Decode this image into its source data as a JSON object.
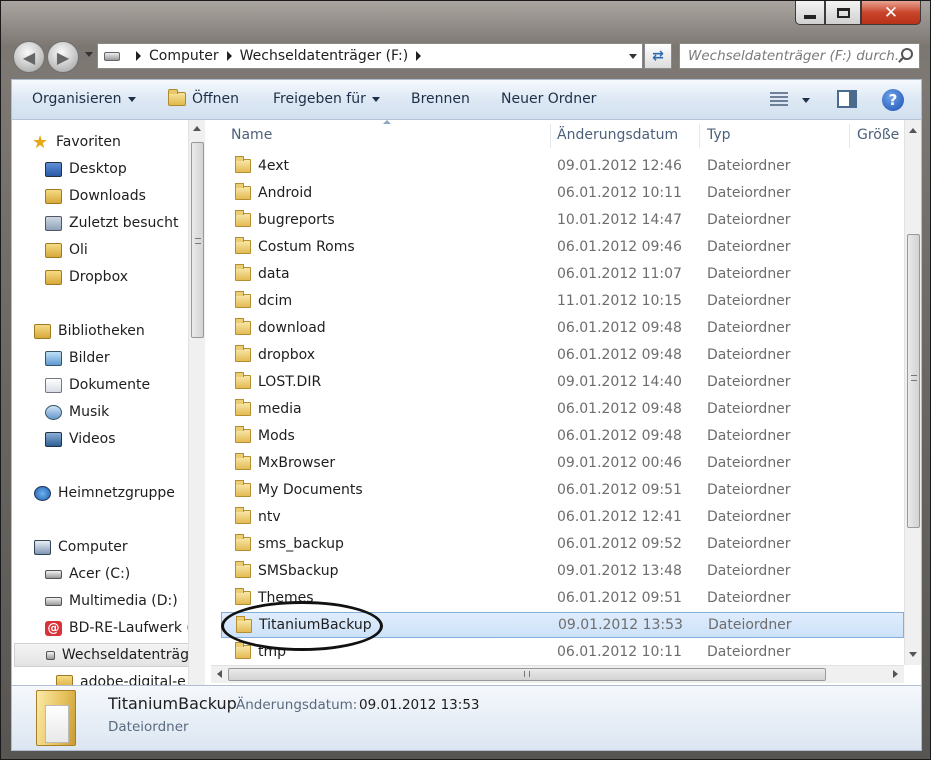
{
  "window": {
    "controls": {
      "minimize": "minimize",
      "maximize": "maximize",
      "close": "✕"
    }
  },
  "nav": {
    "breadcrumbs": [
      "Computer",
      "Wechseldatenträger (F:)"
    ],
    "search_placeholder": "Wechseldatenträger (F:) durch..."
  },
  "toolbar": {
    "organize": "Organisieren",
    "open": "Öffnen",
    "share": "Freigeben für",
    "burn": "Brennen",
    "new_folder": "Neuer Ordner",
    "help": "?"
  },
  "sidebar": {
    "favorites": {
      "label": "Favoriten",
      "items": [
        {
          "label": "Desktop",
          "icon": "desktop-icon"
        },
        {
          "label": "Downloads",
          "icon": "downloads-folder-icon"
        },
        {
          "label": "Zuletzt besucht",
          "icon": "recent-places-icon"
        },
        {
          "label": "Oli",
          "icon": "user-folder-icon"
        },
        {
          "label": "Dropbox",
          "icon": "dropbox-folder-icon"
        }
      ]
    },
    "libraries": {
      "label": "Bibliotheken",
      "items": [
        {
          "label": "Bilder",
          "icon": "pictures-icon"
        },
        {
          "label": "Dokumente",
          "icon": "documents-icon"
        },
        {
          "label": "Musik",
          "icon": "music-icon"
        },
        {
          "label": "Videos",
          "icon": "videos-icon"
        }
      ]
    },
    "homegroup": {
      "label": "Heimnetzgruppe"
    },
    "computer": {
      "label": "Computer",
      "items": [
        {
          "label": "Acer (C:)",
          "icon": "drive-icon"
        },
        {
          "label": "Multimedia (D:)",
          "icon": "drive-icon"
        },
        {
          "label": "BD-RE-Laufwerk (",
          "icon": "bd-drive-icon"
        },
        {
          "label": "Wechseldatenträg",
          "icon": "removable-drive-icon"
        },
        {
          "label": "adobe-digital-e",
          "icon": "folder-icon"
        }
      ]
    }
  },
  "list": {
    "columns": {
      "name": "Name",
      "date": "Änderungsdatum",
      "type": "Typ",
      "size": "Größe"
    },
    "rows": [
      {
        "name": "4ext",
        "date": "09.01.2012 12:46",
        "type": "Dateiordner"
      },
      {
        "name": "Android",
        "date": "06.01.2012 10:11",
        "type": "Dateiordner"
      },
      {
        "name": "bugreports",
        "date": "10.01.2012 14:47",
        "type": "Dateiordner"
      },
      {
        "name": "Costum Roms",
        "date": "06.01.2012 09:46",
        "type": "Dateiordner"
      },
      {
        "name": "data",
        "date": "06.01.2012 11:07",
        "type": "Dateiordner"
      },
      {
        "name": "dcim",
        "date": "11.01.2012 10:15",
        "type": "Dateiordner"
      },
      {
        "name": "download",
        "date": "06.01.2012 09:48",
        "type": "Dateiordner"
      },
      {
        "name": "dropbox",
        "date": "06.01.2012 09:48",
        "type": "Dateiordner"
      },
      {
        "name": "LOST.DIR",
        "date": "09.01.2012 14:40",
        "type": "Dateiordner"
      },
      {
        "name": "media",
        "date": "06.01.2012 09:48",
        "type": "Dateiordner"
      },
      {
        "name": "Mods",
        "date": "06.01.2012 09:48",
        "type": "Dateiordner"
      },
      {
        "name": "MxBrowser",
        "date": "09.01.2012 00:46",
        "type": "Dateiordner"
      },
      {
        "name": "My Documents",
        "date": "06.01.2012 09:51",
        "type": "Dateiordner"
      },
      {
        "name": "ntv",
        "date": "06.01.2012 12:41",
        "type": "Dateiordner"
      },
      {
        "name": "sms_backup",
        "date": "06.01.2012 09:52",
        "type": "Dateiordner"
      },
      {
        "name": "SMSbackup",
        "date": "09.01.2012 13:48",
        "type": "Dateiordner"
      },
      {
        "name": "Themes",
        "date": "06.01.2012 09:51",
        "type": "Dateiordner"
      },
      {
        "name": "TitaniumBackup",
        "date": "09.01.2012 13:53",
        "type": "Dateiordner",
        "selected": true
      },
      {
        "name": "tmp",
        "date": "06.01.2012 10:11",
        "type": "Dateiordner"
      }
    ]
  },
  "details": {
    "name": "TitaniumBackup",
    "date_label": "Änderungsdatum:",
    "date_value": "09.01.2012 13:53",
    "type": "Dateiordner"
  }
}
